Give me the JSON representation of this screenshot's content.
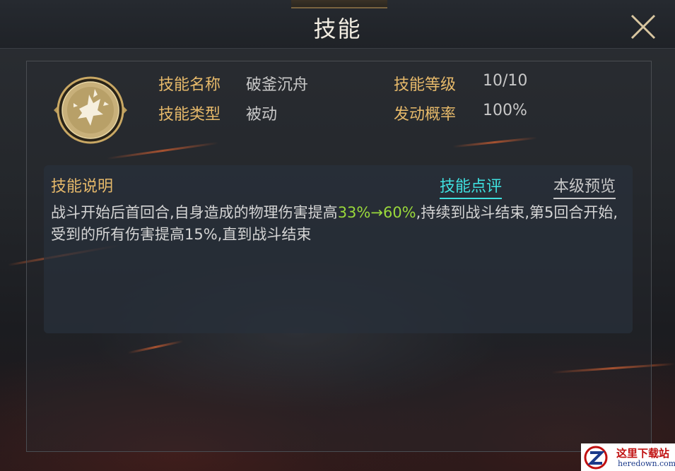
{
  "header": {
    "title": "技能"
  },
  "skill": {
    "name_label": "技能名称",
    "name_value": "破釜沉舟",
    "level_label": "技能等级",
    "level_value": "10/10",
    "type_label": "技能类型",
    "type_value": "被动",
    "rate_label": "发动概率",
    "rate_value": "100%",
    "icon": "shattered-shield-icon"
  },
  "description": {
    "title": "技能说明",
    "tab_review": "技能点评",
    "tab_preview": "本级预览",
    "text_before": "战斗开始后首回合,自身造成的物理伤害提高",
    "text_highlight": "33%→60%",
    "text_after": ",持续到战斗结束,第5回合开始,受到的所有伤害提高15%,直到战斗结束"
  },
  "watermark": {
    "cn": "这里下载站",
    "en": "heredown.com"
  },
  "colors": {
    "label_gold": "#e6b96a",
    "accent_cyan": "#3fe0df",
    "highlight_green": "#9ad93b"
  }
}
